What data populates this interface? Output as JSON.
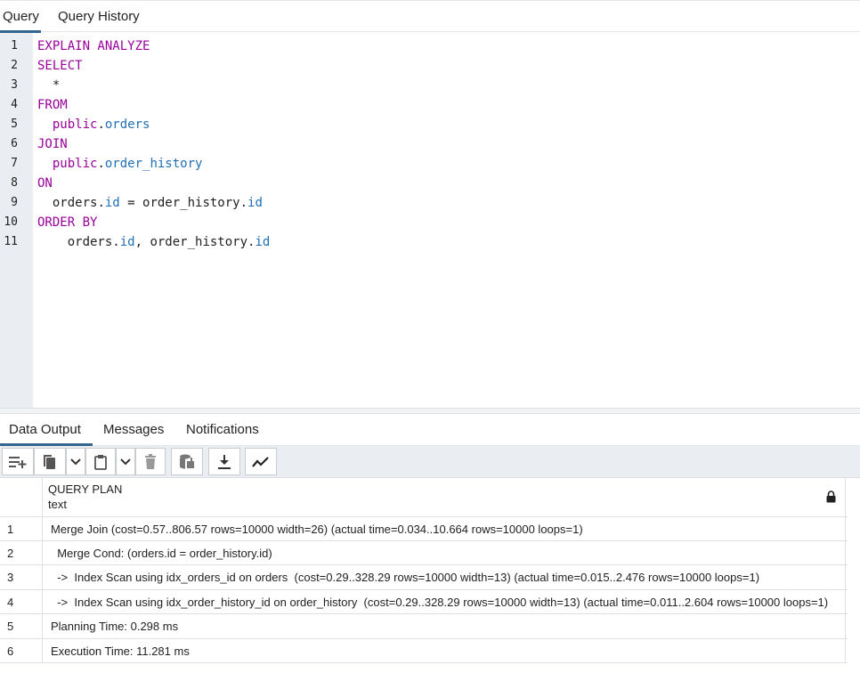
{
  "top_tabs": [
    {
      "label": "Query",
      "active": true
    },
    {
      "label": "Query History",
      "active": false
    }
  ],
  "editor": {
    "line_numbers": [
      "1",
      "2",
      "3",
      "4",
      "5",
      "6",
      "7",
      "8",
      "9",
      "10",
      "11"
    ],
    "lines": [
      {
        "parts": [
          {
            "t": "EXPLAIN ANALYZE",
            "c": "kw"
          }
        ]
      },
      {
        "parts": [
          {
            "t": "SELECT",
            "c": "kw"
          }
        ]
      },
      {
        "parts": [
          {
            "t": "  *",
            "c": ""
          }
        ]
      },
      {
        "parts": [
          {
            "t": "FROM",
            "c": "kw"
          }
        ]
      },
      {
        "parts": [
          {
            "t": "  public",
            "c": "kw"
          },
          {
            "t": ".",
            "c": ""
          },
          {
            "t": "orders",
            "c": "fld"
          }
        ]
      },
      {
        "parts": [
          {
            "t": "JOIN",
            "c": "kw"
          }
        ]
      },
      {
        "parts": [
          {
            "t": "  public",
            "c": "kw"
          },
          {
            "t": ".",
            "c": ""
          },
          {
            "t": "order_history",
            "c": "fld"
          }
        ]
      },
      {
        "parts": [
          {
            "t": "ON",
            "c": "kw"
          }
        ]
      },
      {
        "parts": [
          {
            "t": "  orders",
            "c": ""
          },
          {
            "t": ".",
            "c": ""
          },
          {
            "t": "id",
            "c": "fld"
          },
          {
            "t": " = order_history",
            "c": ""
          },
          {
            "t": ".",
            "c": ""
          },
          {
            "t": "id",
            "c": "fld"
          }
        ]
      },
      {
        "parts": [
          {
            "t": "ORDER BY",
            "c": "kw"
          }
        ]
      },
      {
        "parts": [
          {
            "t": "    orders",
            "c": ""
          },
          {
            "t": ".",
            "c": ""
          },
          {
            "t": "id",
            "c": "fld"
          },
          {
            "t": ", order_history",
            "c": ""
          },
          {
            "t": ".",
            "c": ""
          },
          {
            "t": "id",
            "c": "fld"
          }
        ]
      }
    ]
  },
  "bottom_tabs": [
    {
      "label": "Data Output",
      "active": true
    },
    {
      "label": "Messages",
      "active": false
    },
    {
      "label": "Notifications",
      "active": false
    }
  ],
  "toolbar": {
    "buttons": [
      "add-row-icon",
      "copy-icon",
      "chevron-down-icon",
      "paste-icon",
      "chevron-down-icon",
      "delete-icon",
      "save-data-icon",
      "download-icon",
      "graph-icon"
    ]
  },
  "grid": {
    "column_name": "QUERY PLAN",
    "column_type": "text",
    "rows": [
      {
        "num": "1",
        "value": "Merge Join  (cost=0.57..806.57 rows=10000 width=26) (actual time=0.034..10.664 rows=10000 loops=1)"
      },
      {
        "num": "2",
        "value": "  Merge Cond: (orders.id = order_history.id)"
      },
      {
        "num": "3",
        "value": "  ->  Index Scan using idx_orders_id on orders  (cost=0.29..328.29 rows=10000 width=13) (actual time=0.015..2.476 rows=10000 loops=1)"
      },
      {
        "num": "4",
        "value": "  ->  Index Scan using idx_order_history_id on order_history  (cost=0.29..328.29 rows=10000 width=13) (actual time=0.011..2.604 rows=10000 loops=1)"
      },
      {
        "num": "5",
        "value": "Planning Time: 0.298 ms"
      },
      {
        "num": "6",
        "value": "Execution Time: 11.281 ms"
      }
    ]
  },
  "colors": {
    "accent": "#326690",
    "keyword": "#990099",
    "field": "#1f6fb5",
    "gutter": "#eaedf1"
  }
}
